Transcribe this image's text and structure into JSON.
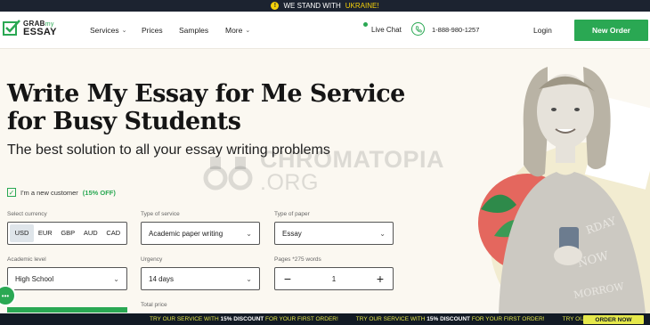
{
  "banner": {
    "text": "WE STAND WITH",
    "highlight": "UKRAINE!",
    "icon": "info-icon"
  },
  "header": {
    "logo": {
      "top": "GRAB",
      "top_small": "my",
      "bottom": "ESSAY"
    },
    "nav": [
      {
        "label": "Services",
        "has_dropdown": true
      },
      {
        "label": "Prices",
        "has_dropdown": false
      },
      {
        "label": "Samples",
        "has_dropdown": false
      },
      {
        "label": "More",
        "has_dropdown": true
      }
    ],
    "live_chat": "Live Chat",
    "phone": "1-888-980-1257",
    "login": "Login",
    "new_order": "New Order"
  },
  "hero": {
    "title_line1": "Write My Essay for Me Service",
    "title_line2": "for Busy Students",
    "subtitle": "The best solution to all your essay writing problems"
  },
  "watermark": {
    "line1": "CHROMATOPIA",
    "line2": ".ORG"
  },
  "form": {
    "new_customer_label": "I'm a new customer",
    "new_customer_discount": "(15% OFF)",
    "new_customer_checked": true,
    "currency_label": "Select currency",
    "currencies": [
      "USD",
      "EUR",
      "GBP",
      "AUD",
      "CAD"
    ],
    "currency_selected": "USD",
    "service_label": "Type of service",
    "service_value": "Academic paper writing",
    "paper_label": "Type of paper",
    "paper_value": "Essay",
    "level_label": "Academic level",
    "level_value": "High School",
    "urgency_label": "Urgency",
    "urgency_value": "14 days",
    "pages_label": "Pages *275 words",
    "pages_value": "1",
    "total_label": "Total price"
  },
  "promo": {
    "message_prefix": "TRY OUR SERVICE WITH",
    "message_discount": "15% DISCOUNT",
    "message_suffix": "FOR YOUR FIRST ORDER!",
    "order_now": "ORDER NOW"
  },
  "colors": {
    "accent": "#2aa853",
    "dark": "#1c2330",
    "promo_yellow": "#e5e84b"
  }
}
